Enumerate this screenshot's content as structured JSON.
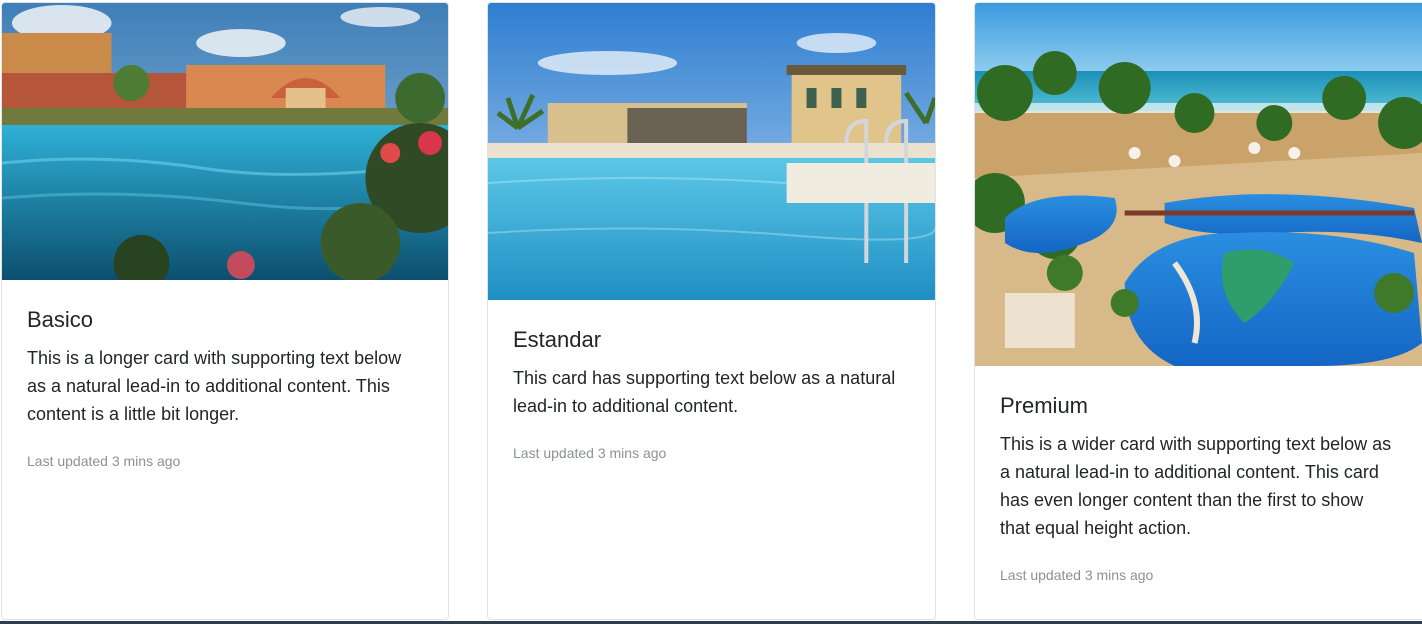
{
  "cards": [
    {
      "title": "Basico",
      "text": "This is a longer card with supporting text below as a natural lead-in to additional content. This content is a little bit longer.",
      "updated": "Last updated 3 mins ago",
      "image": "resort-pool-photo"
    },
    {
      "title": "Estandar",
      "text": "This card has supporting text below as a natural lead-in to additional content.",
      "updated": "Last updated 3 mins ago",
      "image": "hotel-pool-photo"
    },
    {
      "title": "Premium",
      "text": "This is a wider card with supporting text below as a natural lead-in to additional content. This card has even longer content than the first to show that equal height action.",
      "updated": "Last updated 3 mins ago",
      "image": "beach-resort-pool-photo"
    }
  ],
  "colors": {
    "title_text": "#212529",
    "muted_text": "#8a9298",
    "card_border": "#dfe3e6",
    "pool_blue": "#2f9fd0",
    "sky_blue": "#4a9ad8"
  }
}
